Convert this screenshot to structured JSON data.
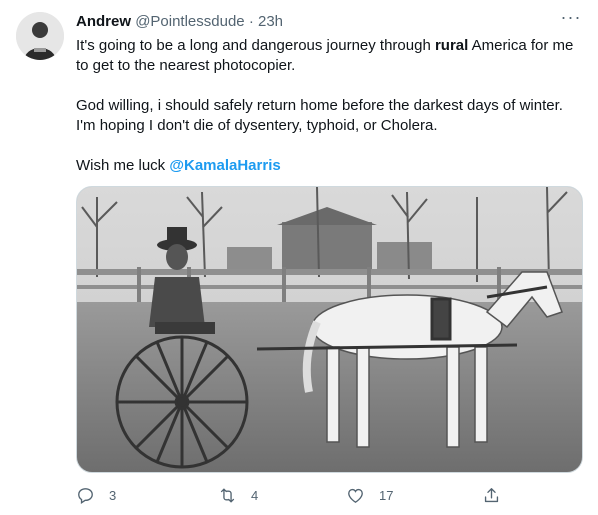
{
  "author": {
    "name": "Andrew",
    "handle": "@Pointlessdude",
    "separator": "·",
    "time": "23h"
  },
  "more_icon": "ellipsis-icon",
  "body": {
    "line1_pre": "It's going to be a long and dangerous journey through ",
    "line1_bold": "rural",
    "line1_post": " America for me to get to the nearest photocopier.",
    "line2": "God willing, i should safely return home before the darkest days of winter. I'm hoping I don't die of dysentery, typhoid, or Cholera.",
    "line3_pre": "Wish me luck ",
    "mention": "@KamalaHarris"
  },
  "actions": {
    "reply_count": "3",
    "retweet_count": "4",
    "like_count": "17"
  },
  "colors": {
    "accent": "#1d9bf0",
    "secondary_text": "#536471",
    "border": "#cfd9de"
  }
}
